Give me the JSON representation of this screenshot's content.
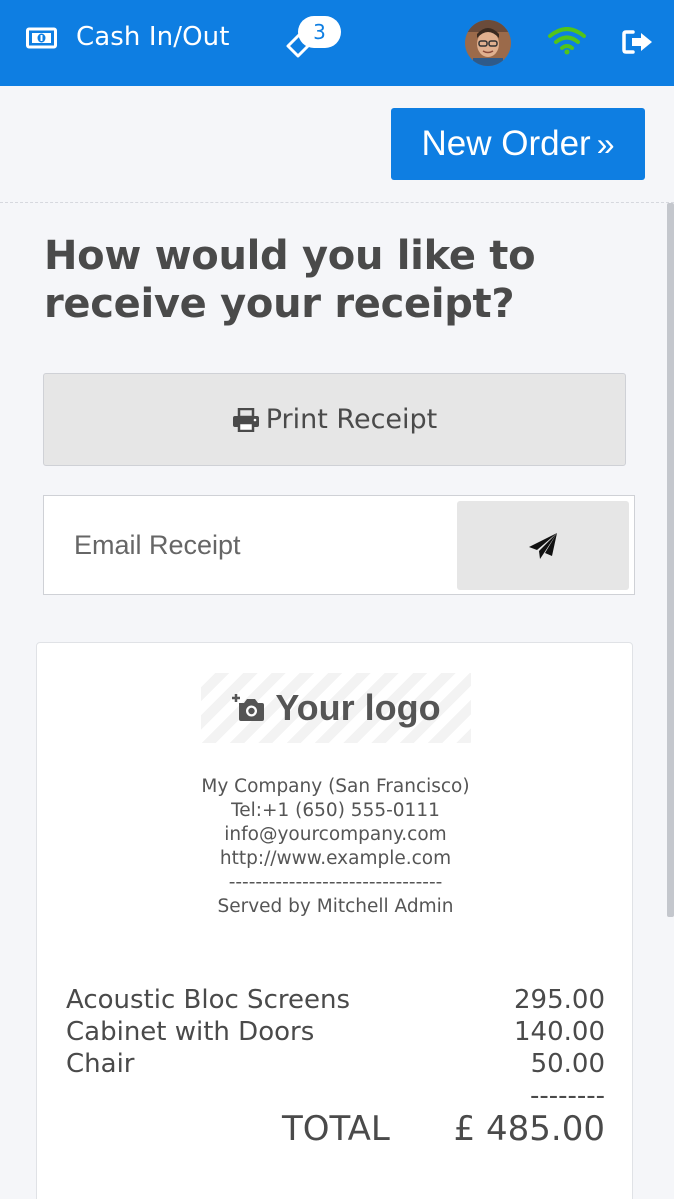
{
  "header": {
    "cash_label": "Cash In/Out",
    "ticket_count": "3",
    "wifi_color": "#52c41a",
    "brand_color": "#0e7ee2",
    "icons": [
      "money-icon",
      "tickets-icon",
      "avatar",
      "wifi-icon",
      "logout-icon"
    ]
  },
  "actions": {
    "new_order_label": "New Order",
    "new_order_chevron": "»"
  },
  "receipt_options": {
    "question": "How would you like to receive your receipt?",
    "print_label": "Print Receipt",
    "email_placeholder": "Email Receipt",
    "email_value": ""
  },
  "receipt": {
    "logo_text": "Your logo",
    "company_lines": [
      "My Company (San Francisco)",
      "Tel:+1 (650) 555-0111",
      "info@yourcompany.com",
      "http://www.example.com",
      "--------------------------------",
      "Served by Mitchell Admin"
    ],
    "items": [
      {
        "name": "Acoustic Bloc Screens",
        "price": "295.00"
      },
      {
        "name": "Cabinet with Doors",
        "price": "140.00"
      },
      {
        "name": "Chair",
        "price": "50.00"
      }
    ],
    "separator": "--------",
    "total_label": "TOTAL",
    "total_amount": "£ 485.00"
  }
}
